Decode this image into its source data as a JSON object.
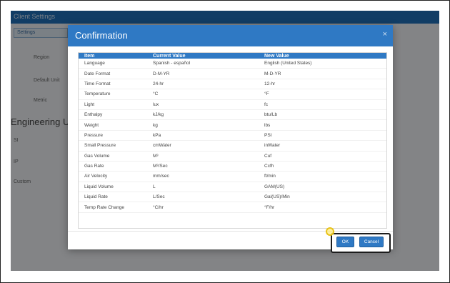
{
  "app": {
    "title": "Client Settings",
    "tab": "Settings",
    "row_labels": [
      "Region",
      "Default Unit",
      "Metric"
    ],
    "heading": "Engineering Un",
    "side_items": [
      "SI",
      "IP",
      "Custom",
      "",
      "",
      ""
    ]
  },
  "dialog": {
    "title": "Confirmation",
    "close_icon": "×",
    "columns": [
      "Item",
      "Current Value",
      "New Value"
    ],
    "rows": [
      [
        "Language",
        "Spanish - español",
        "English (United States)"
      ],
      [
        "Date Format",
        "D-M-YR",
        "M-D-YR"
      ],
      [
        "Time Format",
        "24-hr",
        "12-hr"
      ],
      [
        "Temperature",
        "°C",
        "°F"
      ],
      [
        "Light",
        "lux",
        "fc"
      ],
      [
        "Enthalpy",
        "kJ/kg",
        "btu/Lb"
      ],
      [
        "Weight",
        "kg",
        "lbs"
      ],
      [
        "Pressure",
        "kPa",
        "PSI"
      ],
      [
        "Small Pressure",
        "cmWater",
        "inWater"
      ],
      [
        "Gas Volume",
        "M³",
        "Cuf"
      ],
      [
        "Gas Rate",
        "M³/Sec",
        "Ccfh"
      ],
      [
        "Air Velocity",
        "mm/sec",
        "ft/min"
      ],
      [
        "Liquid Volume",
        "L",
        "GAM(US)"
      ],
      [
        "Liquid Rate",
        "L/Sec",
        "Gal(US)/Min"
      ],
      [
        "Temp Rate Change",
        "°C/hr",
        "°F/hr"
      ]
    ],
    "ok_label": "OK",
    "cancel_label": "Cancel"
  },
  "colors": {
    "header_blue": "#2f79c4",
    "app_bar_blue": "#1f6fb8",
    "highlight_marker": "#e8c21a"
  }
}
